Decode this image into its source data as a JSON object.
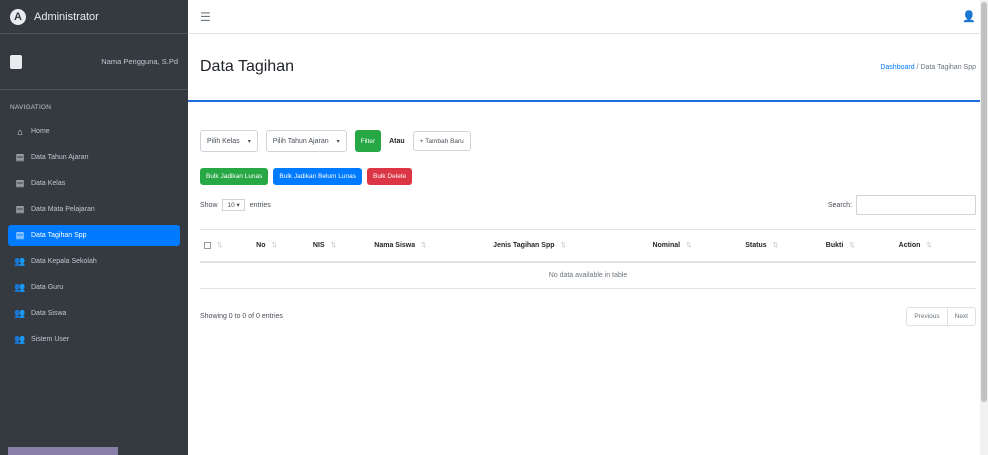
{
  "brand": {
    "title": "Administrator",
    "logo_letter": "A"
  },
  "user": {
    "name": "Nama Pengguna, S.Pd"
  },
  "nav": {
    "header": "NAVIGATION",
    "items": [
      {
        "label": "Home",
        "icon": "home-icon",
        "glyph": "⌂"
      },
      {
        "label": "Data Tahun Ajaran",
        "icon": "book-icon",
        "glyph": "▤"
      },
      {
        "label": "Data Kelas",
        "icon": "book-icon",
        "glyph": "▤"
      },
      {
        "label": "Data Mata Pelajaran",
        "icon": "book-icon",
        "glyph": "▤"
      },
      {
        "label": "Data Tagihan Spp",
        "icon": "book-icon",
        "glyph": "▤",
        "active": true
      },
      {
        "label": "Data Kepala Sekolah",
        "icon": "users-icon",
        "glyph": "👥"
      },
      {
        "label": "Data Guru",
        "icon": "users-icon",
        "glyph": "👥"
      },
      {
        "label": "Data Siswa",
        "icon": "users-icon",
        "glyph": "👥"
      },
      {
        "label": "Sistem User",
        "icon": "users-icon",
        "glyph": "👥"
      }
    ]
  },
  "page": {
    "title": "Data Tagihan",
    "breadcrumb_home": "Dashboard",
    "breadcrumb_sep": "/",
    "breadcrumb_current": "Data Tagihan Spp"
  },
  "filters": {
    "kelas": "Pilih Kelas",
    "tahun": "Pilih Tahun Ajaran",
    "filter_btn": "Filter",
    "atau": "Atau",
    "tambah_btn": "+ Tambah Baru"
  },
  "bulk": {
    "lunas": "Bulk Jadikan Lunas",
    "belum_lunas": "Bulk Jadikan Belum Lunas",
    "delete": "Bulk Delete"
  },
  "table": {
    "show_label": "Show",
    "show_value": "10",
    "entries_label": "entries",
    "search_label": "Search:",
    "columns": [
      "No",
      "NIS",
      "Nama Siswa",
      "Jenis Tagihan Spp",
      "Nominal",
      "Status",
      "Bukti",
      "Action"
    ],
    "empty_text": "No data available in table",
    "info": "Showing 0 to 0 of 0 entries",
    "previous": "Previous",
    "next": "Next"
  },
  "colors": {
    "sidebar_bg": "#343a40",
    "active": "#007bff",
    "success": "#28a745",
    "danger": "#dc3545"
  }
}
